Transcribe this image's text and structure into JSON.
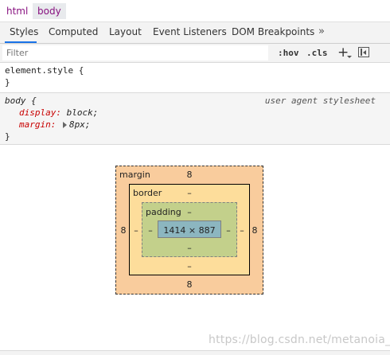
{
  "breadcrumbs": [
    "html",
    "body"
  ],
  "tabs": [
    "Styles",
    "Computed",
    "Layout",
    "Event Listeners",
    "DOM Breakpoints"
  ],
  "tabs_overflow_icon": "double-chevron-right-icon",
  "filter": {
    "placeholder": "Filter",
    "value": ""
  },
  "toolbar": {
    "hov": ":hov",
    "cls": ".cls",
    "new_rule_icon": "plus-icon",
    "sidebar_icon": "sidebar-toggle-icon"
  },
  "rules": {
    "element_style": {
      "selector": "element.style {",
      "close": "}"
    },
    "body_rule": {
      "selector": "body {",
      "origin": "user agent stylesheet",
      "declarations": [
        {
          "prop": "display",
          "value": "block;"
        },
        {
          "prop": "margin",
          "value": "8px;"
        }
      ],
      "close": "}"
    }
  },
  "box_model": {
    "margin": {
      "label": "margin",
      "top": "8",
      "right": "8",
      "bottom": "8",
      "left": "8"
    },
    "border": {
      "label": "border",
      "top": "–",
      "right": "–",
      "bottom": "–",
      "left": "–"
    },
    "padding": {
      "label": "padding",
      "top": "–",
      "right": "–",
      "bottom": "–",
      "left": "–"
    },
    "content": "1414 × 887"
  },
  "watermark": "https://blog.csdn.net/metanoia_",
  "colors": {
    "margin": "#f9cc9d",
    "border": "#fddd9b",
    "padding": "#c3d08b",
    "content": "#8cb6c0",
    "active_tab": "#1a73e8",
    "property": "#c80000"
  }
}
